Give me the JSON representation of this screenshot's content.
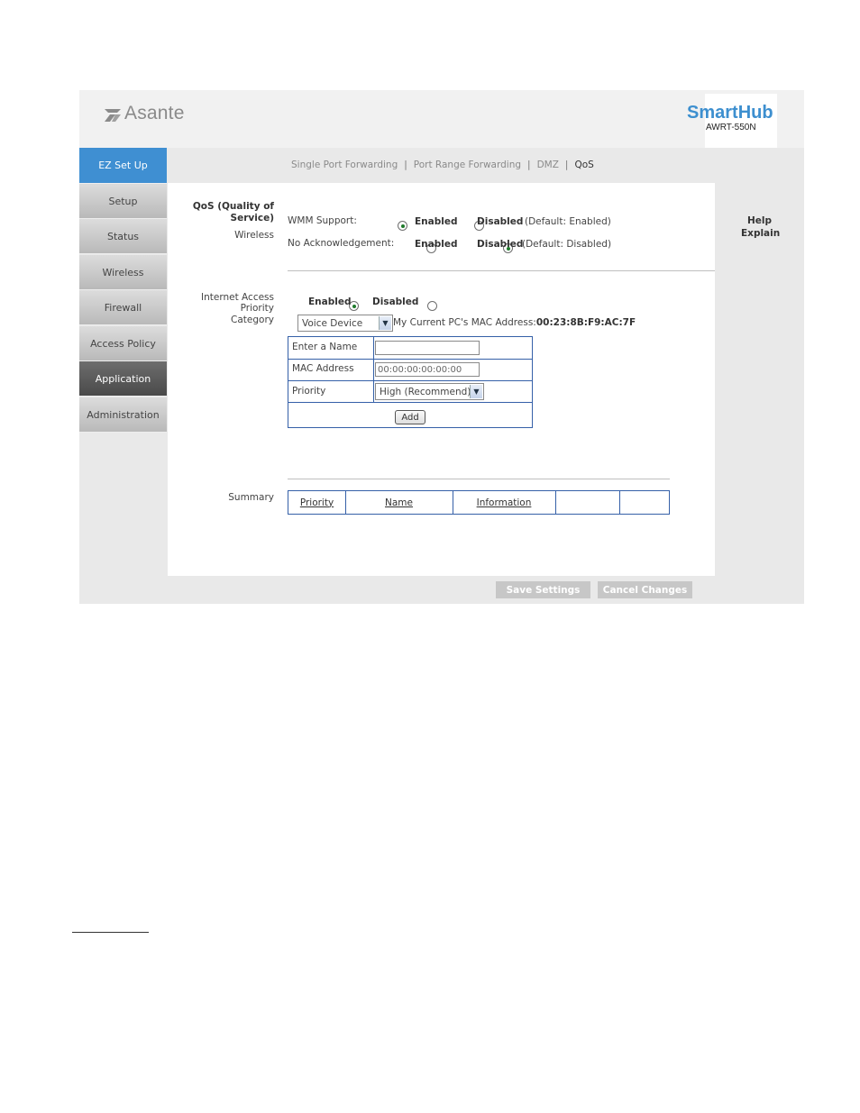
{
  "header": {
    "brand": "Asante",
    "product": "SmartHub",
    "model": "AWRT-550N"
  },
  "sidebar": {
    "items": [
      {
        "label": "EZ Set Up"
      },
      {
        "label": "Setup"
      },
      {
        "label": "Status"
      },
      {
        "label": "Wireless"
      },
      {
        "label": "Firewall"
      },
      {
        "label": "Access Policy"
      },
      {
        "label": "Application"
      },
      {
        "label": "Administration"
      }
    ]
  },
  "tabs": {
    "items": [
      "Single Port Forwarding",
      "Port Range Forwarding",
      "DMZ",
      "QoS"
    ],
    "separator": "|"
  },
  "qos": {
    "section_title": "QoS (Quality of Service)",
    "wireless_label": "Wireless",
    "wmm_label": "WMM Support:",
    "wmm_enabled": "Enabled",
    "wmm_disabled": "Disabled",
    "wmm_default": "(Default: Enabled)",
    "noack_label": "No Acknowledgement:",
    "noack_enabled": "Enabled",
    "noack_disabled": "Disabled",
    "noack_default": "(Default: Disabled)"
  },
  "priority": {
    "label": "Internet Access Priority",
    "enabled": "Enabled",
    "disabled": "Disabled",
    "category_label": "Category",
    "category_value": "Voice Device",
    "mac_info_prefix": "My Current PC's MAC Address:",
    "mac_info_value": "00:23:8B:F9:AC:7F"
  },
  "form": {
    "name_label": "Enter a Name",
    "name_value": "",
    "mac_label": "MAC Address",
    "mac_value": "00:00:00:00:00:00",
    "priority_label": "Priority",
    "priority_value": "High (Recommend)",
    "add_button": "Add"
  },
  "summary": {
    "label": "Summary",
    "columns": [
      "Priority",
      "Name",
      "Information",
      "",
      ""
    ]
  },
  "help": {
    "title": "Help",
    "link": "Explain"
  },
  "footer": {
    "save": "Save Settings",
    "cancel": "Cancel Changes"
  }
}
